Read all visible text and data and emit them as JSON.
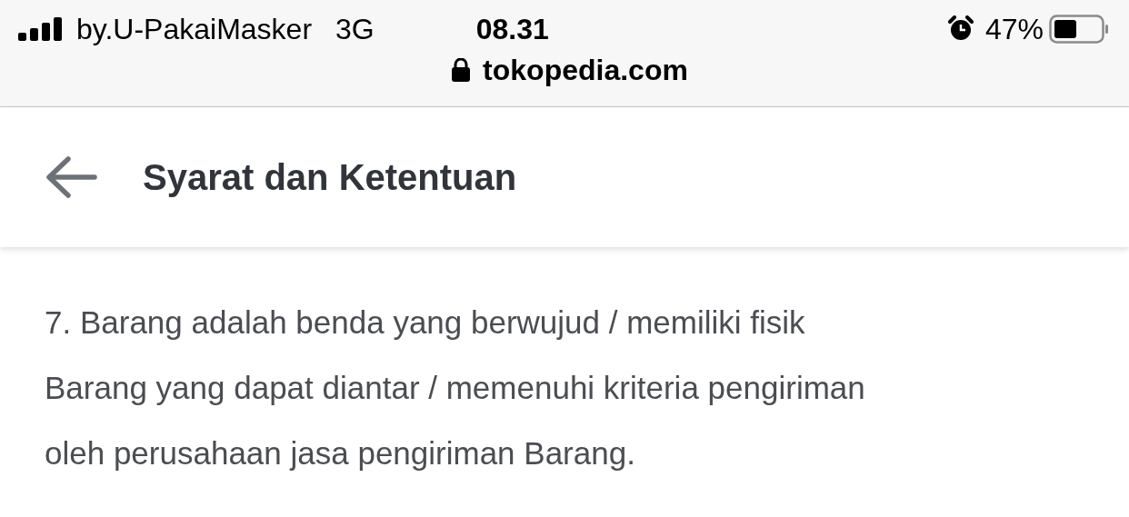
{
  "status_bar": {
    "carrier": "by.U-PakaiMasker",
    "network": "3G",
    "time": "08.31",
    "battery": "47%"
  },
  "address_bar": {
    "url": "tokopedia.com"
  },
  "header": {
    "title": "Syarat dan Ketentuan"
  },
  "content": {
    "lines": [
      "7. Barang adalah benda yang berwujud / memiliki fisik",
      "Barang yang dapat diantar / memenuhi kriteria pengiriman",
      "oleh perusahaan jasa pengiriman Barang."
    ]
  }
}
